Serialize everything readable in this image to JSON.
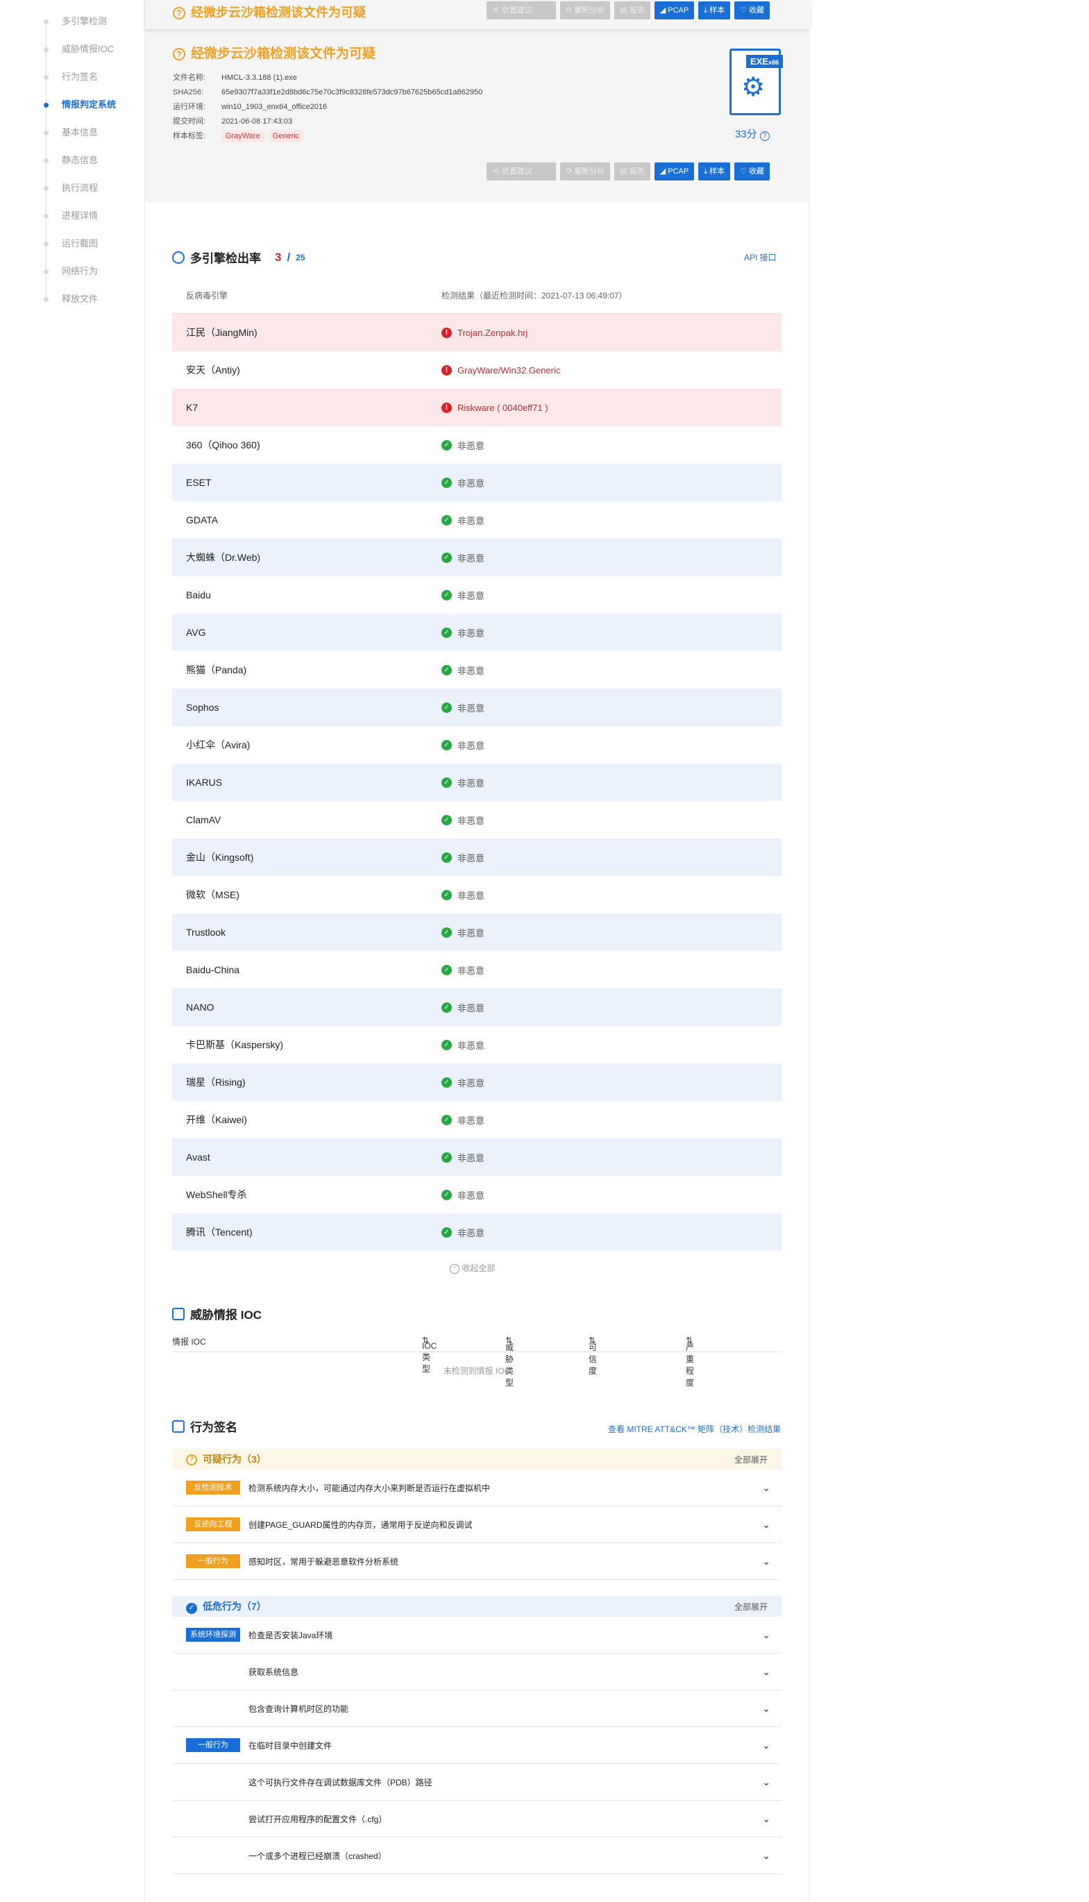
{
  "sidebar": {
    "items": [
      {
        "label": "多引擎检测"
      },
      {
        "label": "威胁情报IOC"
      },
      {
        "label": "行为签名"
      },
      {
        "label": "情报判定系统",
        "active": true
      },
      {
        "label": "基本信息"
      },
      {
        "label": "静态信息"
      },
      {
        "label": "执行流程"
      },
      {
        "label": "进程详情"
      },
      {
        "label": "运行截图"
      },
      {
        "label": "网络行为"
      },
      {
        "label": "释放文件"
      }
    ]
  },
  "summary": {
    "verdict": "经微步云沙箱检测该文件为可疑",
    "buttons": {
      "suggest": "处置建议",
      "reanalyze": "重新分析",
      "report": "报告",
      "pcap": "PCAP",
      "sample": "样本",
      "favorite": "收藏"
    },
    "fields": [
      {
        "key": "文件名称:",
        "value": "HMCL-3.3.188 (1).exe"
      },
      {
        "key": "SHA256:",
        "value": "65e9307f7a33f1e2d8bd6c75e70c3f9c8328fe573dc97b67625b65cd1a862950"
      },
      {
        "key": "运行环境:",
        "value": "win10_1903_enx64_office2016"
      },
      {
        "key": "提交时间:",
        "value": "2021-06-08 17:43:03"
      }
    ],
    "tags_label": "样本标签:",
    "tags": [
      "GrayWare",
      "Generic"
    ],
    "file_type": "EXE",
    "file_arch": "x86",
    "score": "33分",
    "colors": {
      "accent": "#1a6fd6",
      "warning": "#f0a020",
      "danger": "#d6202a",
      "safe": "#28a745"
    }
  },
  "engines": {
    "title": "多引擎检出率",
    "detected": "3",
    "separator": "/",
    "total": "25",
    "api_link": "API 接口",
    "col_engine": "反病毒引擎",
    "col_result": "检测结果（最近检测时间：2021-07-13 06:49:07）",
    "rows": [
      {
        "name": "江民（JiangMin)",
        "result": "Trojan.Zenpak.hrj",
        "malicious": true
      },
      {
        "name": "安天（Antiy)",
        "result": "GrayWare/Win32.Generic",
        "malicious": true
      },
      {
        "name": "K7",
        "result": "Riskware ( 0040eff71 )",
        "malicious": true
      },
      {
        "name": "360（Qihoo 360)",
        "result": "非恶意",
        "malicious": false
      },
      {
        "name": "ESET",
        "result": "非恶意",
        "malicious": false
      },
      {
        "name": "GDATA",
        "result": "非恶意",
        "malicious": false
      },
      {
        "name": "大蜘蛛（Dr.Web)",
        "result": "非恶意",
        "malicious": false
      },
      {
        "name": "Baidu",
        "result": "非恶意",
        "malicious": false
      },
      {
        "name": "AVG",
        "result": "非恶意",
        "malicious": false
      },
      {
        "name": "熊猫（Panda)",
        "result": "非恶意",
        "malicious": false
      },
      {
        "name": "Sophos",
        "result": "非恶意",
        "malicious": false
      },
      {
        "name": "小红伞（Avira)",
        "result": "非恶意",
        "malicious": false
      },
      {
        "name": "IKARUS",
        "result": "非恶意",
        "malicious": false
      },
      {
        "name": "ClamAV",
        "result": "非恶意",
        "malicious": false
      },
      {
        "name": "金山（Kingsoft)",
        "result": "非恶意",
        "malicious": false
      },
      {
        "name": "微软（MSE)",
        "result": "非恶意",
        "malicious": false
      },
      {
        "name": "Trustlook",
        "result": "非恶意",
        "malicious": false
      },
      {
        "name": "Baidu-China",
        "result": "非恶意",
        "malicious": false
      },
      {
        "name": "NANO",
        "result": "非恶意",
        "malicious": false
      },
      {
        "name": "卡巴斯基（Kaspersky)",
        "result": "非恶意",
        "malicious": false
      },
      {
        "name": "瑞星（Rising)",
        "result": "非恶意",
        "malicious": false
      },
      {
        "name": "开维（Kaiwei)",
        "result": "非恶意",
        "malicious": false
      },
      {
        "name": "Avast",
        "result": "非恶意",
        "malicious": false
      },
      {
        "name": "WebShell专杀",
        "result": "非恶意",
        "malicious": false
      },
      {
        "name": "腾讯（Tencent)",
        "result": "非恶意",
        "malicious": false
      }
    ],
    "collapse": "收起全部"
  },
  "ioc": {
    "title": "威胁情报 IOC",
    "columns": [
      "情报 IOC",
      "IOC 类型",
      "威胁类型",
      "可信度",
      "严重程度"
    ],
    "empty": "未检测到情报 IOC"
  },
  "behavior": {
    "title": "行为签名",
    "mitre_link": "查看 MITRE ATT&CK™ 矩阵（技术）检测结果",
    "expand_all": "全部展开",
    "suspicious": {
      "label": "可疑行为（3）",
      "items": [
        {
          "tag": "反检测技术",
          "text": "检测系统内存大小，可能通过内存大小来判断是否运行在虚拟机中"
        },
        {
          "tag": "反逆向工程",
          "text": "创建PAGE_GUARD属性的内存页，通常用于反逆向和反调试"
        },
        {
          "tag": "一般行为",
          "text": "感知时区，常用于躲避恶意软件分析系统"
        }
      ]
    },
    "low": {
      "label": "低危行为（7）",
      "items": [
        {
          "tag": "系统环境探测",
          "text": "检查是否安装Java环境"
        },
        {
          "tag": "",
          "text": "获取系统信息"
        },
        {
          "tag": "",
          "text": "包含查询计算机时区的功能"
        },
        {
          "tag": "一般行为",
          "text": "在临时目录中创建文件"
        },
        {
          "tag": "",
          "text": "这个可执行文件存在调试数据库文件（PDB）路径"
        },
        {
          "tag": "",
          "text": "尝试打开应用程序的配置文件（.cfg）"
        },
        {
          "tag": "",
          "text": "一个或多个进程已经崩溃（crashed）"
        }
      ]
    }
  }
}
